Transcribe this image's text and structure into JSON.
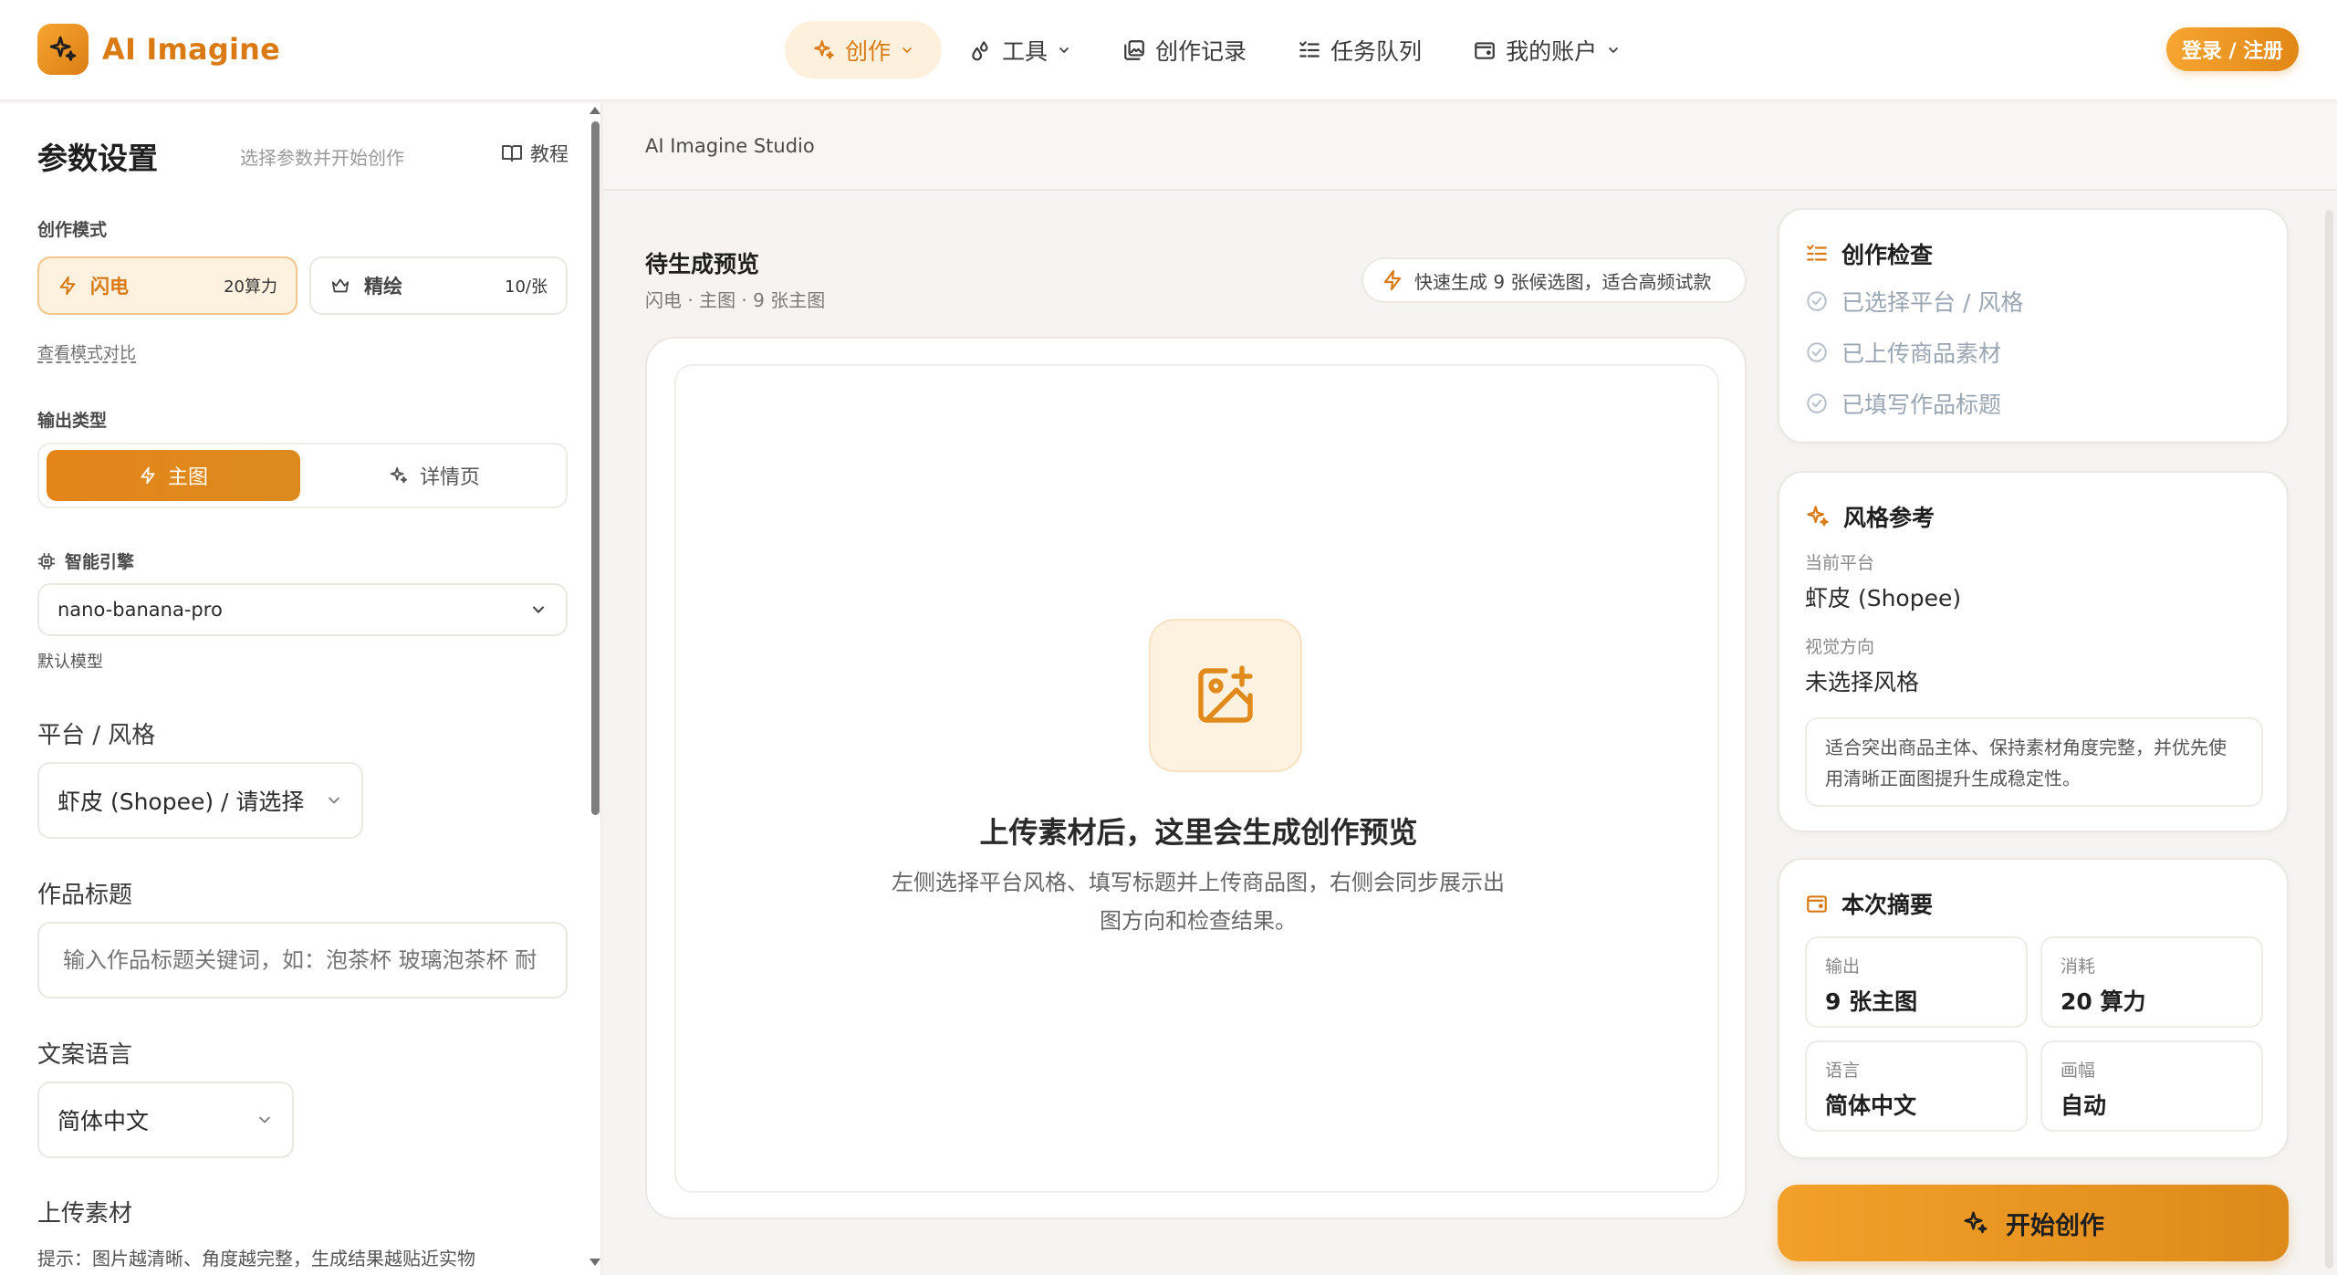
{
  "brand": {
    "name": "AI Imagine"
  },
  "nav": {
    "items": [
      {
        "label": "创作",
        "icon": "sparkle-icon",
        "has_dropdown": true,
        "active": true
      },
      {
        "label": "工具",
        "icon": "drops-icon",
        "has_dropdown": true,
        "active": false
      },
      {
        "label": "创作记录",
        "icon": "gallery-icon",
        "has_dropdown": false,
        "active": false
      },
      {
        "label": "任务队列",
        "icon": "list-check-icon",
        "has_dropdown": false,
        "active": false
      },
      {
        "label": "我的账户",
        "icon": "wallet-icon",
        "has_dropdown": true,
        "active": false
      }
    ],
    "login_label": "登录 / 注册"
  },
  "sidebar": {
    "title": "参数设置",
    "subtitle": "选择参数并开始创作",
    "tutorial_label": "教程",
    "mode_section_label": "创作模式",
    "modes": [
      {
        "label": "闪电",
        "price": "20算力",
        "icon": "bolt-icon",
        "active": true
      },
      {
        "label": "精绘",
        "price": "10/张",
        "icon": "crown-icon",
        "active": false
      }
    ],
    "compare_link": "查看模式对比",
    "output_section_label": "输出类型",
    "output_types": [
      {
        "label": "主图",
        "icon": "bolt-icon",
        "active": true
      },
      {
        "label": "详情页",
        "icon": "sparkle-icon",
        "active": false
      }
    ],
    "engine_label": "智能引擎",
    "engine_value": "nano-banana-pro",
    "engine_note": "默认模型",
    "platform_label": "平台 / 风格",
    "platform_value": "虾皮 (Shopee) / 请选择",
    "title_label": "作品标题",
    "title_placeholder": "输入作品标题关键词，如：泡茶杯 玻璃泡茶杯 耐",
    "language_label": "文案语言",
    "language_value": "简体中文",
    "upload_label": "上传素材",
    "upload_hint": "提示：图片越清晰、角度越完整，生成结果越贴近实物"
  },
  "main": {
    "studio_label": "AI Imagine Studio",
    "preview_title": "待生成预览",
    "preview_subtitle": "闪电 · 主图 · 9 张主图",
    "fast_pill": "快速生成 9 张候选图，适合高频试款",
    "empty_title": "上传素材后，这里会生成创作预览",
    "empty_desc": "左侧选择平台风格、填写标题并上传商品图，右侧会同步展示出图方向和检查结果。"
  },
  "check_panel": {
    "title": "创作检查",
    "items": [
      "已选择平台 / 风格",
      "已上传商品素材",
      "已填写作品标题"
    ]
  },
  "style_panel": {
    "title": "风格参考",
    "platform_label": "当前平台",
    "platform_value": "虾皮 (Shopee)",
    "direction_label": "视觉方向",
    "direction_value": "未选择风格",
    "note": "适合突出商品主体、保持素材角度完整，并优先使用清晰正面图提升生成稳定性。"
  },
  "summary_panel": {
    "title": "本次摘要",
    "stats": [
      {
        "label": "输出",
        "value": "9 张主图"
      },
      {
        "label": "消耗",
        "value": "20 算力"
      },
      {
        "label": "语言",
        "value": "简体中文"
      },
      {
        "label": "画幅",
        "value": "自动"
      }
    ]
  },
  "start_button": {
    "label": "开始创作"
  },
  "colors": {
    "accent": "#d97a14",
    "accent_light": "#fdf1e0",
    "check_gray": "#9aa6b3"
  }
}
